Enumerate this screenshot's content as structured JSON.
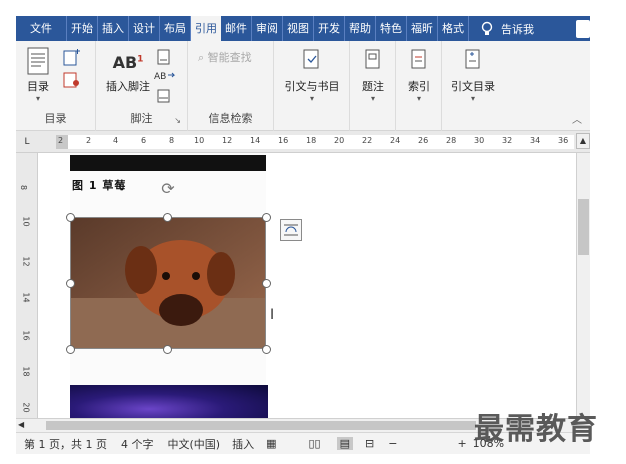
{
  "tabs": [
    {
      "label": "文件",
      "active": false
    },
    {
      "label": "开始",
      "active": false
    },
    {
      "label": "插入",
      "active": false
    },
    {
      "label": "设计",
      "active": false
    },
    {
      "label": "布局",
      "active": false
    },
    {
      "label": "引用",
      "active": true
    },
    {
      "label": "邮件",
      "active": false
    },
    {
      "label": "审阅",
      "active": false
    },
    {
      "label": "视图",
      "active": false
    },
    {
      "label": "开发",
      "active": false
    },
    {
      "label": "帮助",
      "active": false
    },
    {
      "label": "特色",
      "active": false
    },
    {
      "label": "福昕",
      "active": false
    },
    {
      "label": "格式",
      "active": false
    }
  ],
  "tell_me": "告诉我",
  "ribbon": {
    "toc": {
      "button": "目录",
      "group": "目录"
    },
    "footnotes": {
      "insert": "插入脚注",
      "group": "脚注",
      "ab": "AB"
    },
    "research": {
      "smart_lookup": "智能查找",
      "group": "信息检索"
    },
    "citations": {
      "button": "引文与书目"
    },
    "captions": {
      "button": "题注"
    },
    "index": {
      "button": "索引"
    },
    "authorities": {
      "button": "引文目录"
    }
  },
  "ruler": {
    "corner": "L",
    "ticks": [
      "2",
      "2",
      "4",
      "6",
      "8",
      "10",
      "12",
      "14",
      "16",
      "18",
      "20",
      "22",
      "24",
      "26",
      "28",
      "30",
      "32",
      "34",
      "36"
    ]
  },
  "vruler_ticks": [
    "8",
    "10",
    "12",
    "14",
    "16",
    "18",
    "20"
  ],
  "document": {
    "caption": "图 1 草莓"
  },
  "status": {
    "page": "第 1 页，共 1 页",
    "words": "4 个字",
    "language": "中文(中国)",
    "mode": "插入",
    "zoom": "108%"
  },
  "watermark": "最需教育"
}
